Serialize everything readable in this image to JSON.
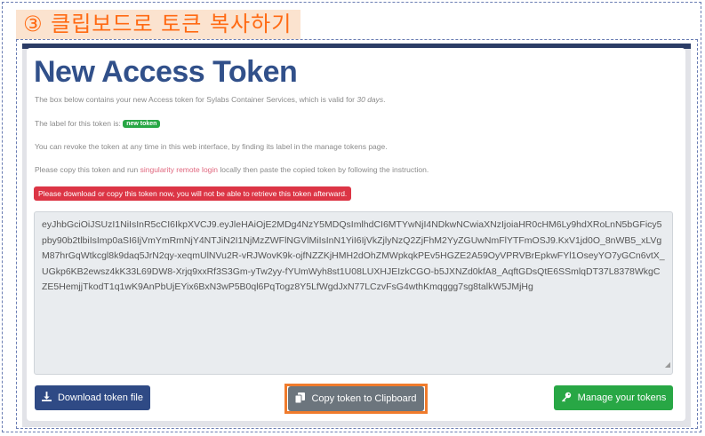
{
  "step_banner": "③ 클립보드로 토큰 복사하기",
  "page": {
    "title": "New Access Token",
    "intro_prefix": "The box below contains your new Access token for Sylabs Container Services, which is valid for ",
    "intro_validity": "30 days",
    "intro_suffix": ".",
    "label_prefix": "The label for this token is: ",
    "label_badge": "new token",
    "revoke_text": "You can revoke the token at any time in this web interface, by finding its label in the manage tokens page.",
    "copy_prefix": "Please copy this token and run ",
    "copy_command": "singularity remote login",
    "copy_suffix": " locally then paste the copied token by following the instruction.",
    "alert": "Please download or copy this token now, you will not be able to retrieve this token afterward."
  },
  "token": "eyJhbGciOiJSUzI1NiIsInR5cCI6IkpXVCJ9.eyJleHAiOjE2MDg4NzY5MDQsImlhdCI6MTYwNjI4NDkwNCwiaXNzIjoiaHR0cHM6Ly9hdXRoLnN5bGFicy5pby90b2tlbiIsImp0aSI6IjVmYmRmNjY4NTJiN2I1NjMzZWFlNGVlMiIsInN1YiI6IjVkZjlyNzQ2ZjFhM2YyZGUwNmFlYTFmOSJ9.KxV1jd0O_8nWB5_xLVgM87hrGqWtkcgl8k9daq5JrN2qy-xeqmUlNVu2R-vRJWovK9k-ojfNZZKjHMH2dOhZMWpkqkPEv5HGZE2A59OyVPRVBrEpkwFYl1OseyYO7yGCn6vtX_UGkp6KB2ewsz4kK33L69DW8-Xrjq9xxRf3S3Gm-yTw2yy-fYUmWyh8st1U08LUXHJEIzkCGO-b5JXNZd0kfA8_AqftGDsQtE6SSmlqDT37L8378WkgCZE5HemjjTkodT1q1wK9AnPbUjEYix6BxN3wP5B0ql6PqTogz8Y5LfWgdJxN77LCzvFsG4wthKmqggg7sg8talkW5JMjHg",
  "buttons": {
    "download": "Download token file",
    "copy": "Copy token to Clipboard",
    "manage": "Manage your tokens"
  },
  "icons": {
    "download": "download-icon",
    "copy": "copy-icon",
    "manage": "key-icon"
  },
  "colors": {
    "title": "#31508a",
    "step_accent": "#ff6a13",
    "alert": "#dc3545",
    "download_button": "#2f4a85",
    "copy_button": "#6c757d",
    "manage_button": "#28a745",
    "highlight_outline": "#f07b2c"
  }
}
